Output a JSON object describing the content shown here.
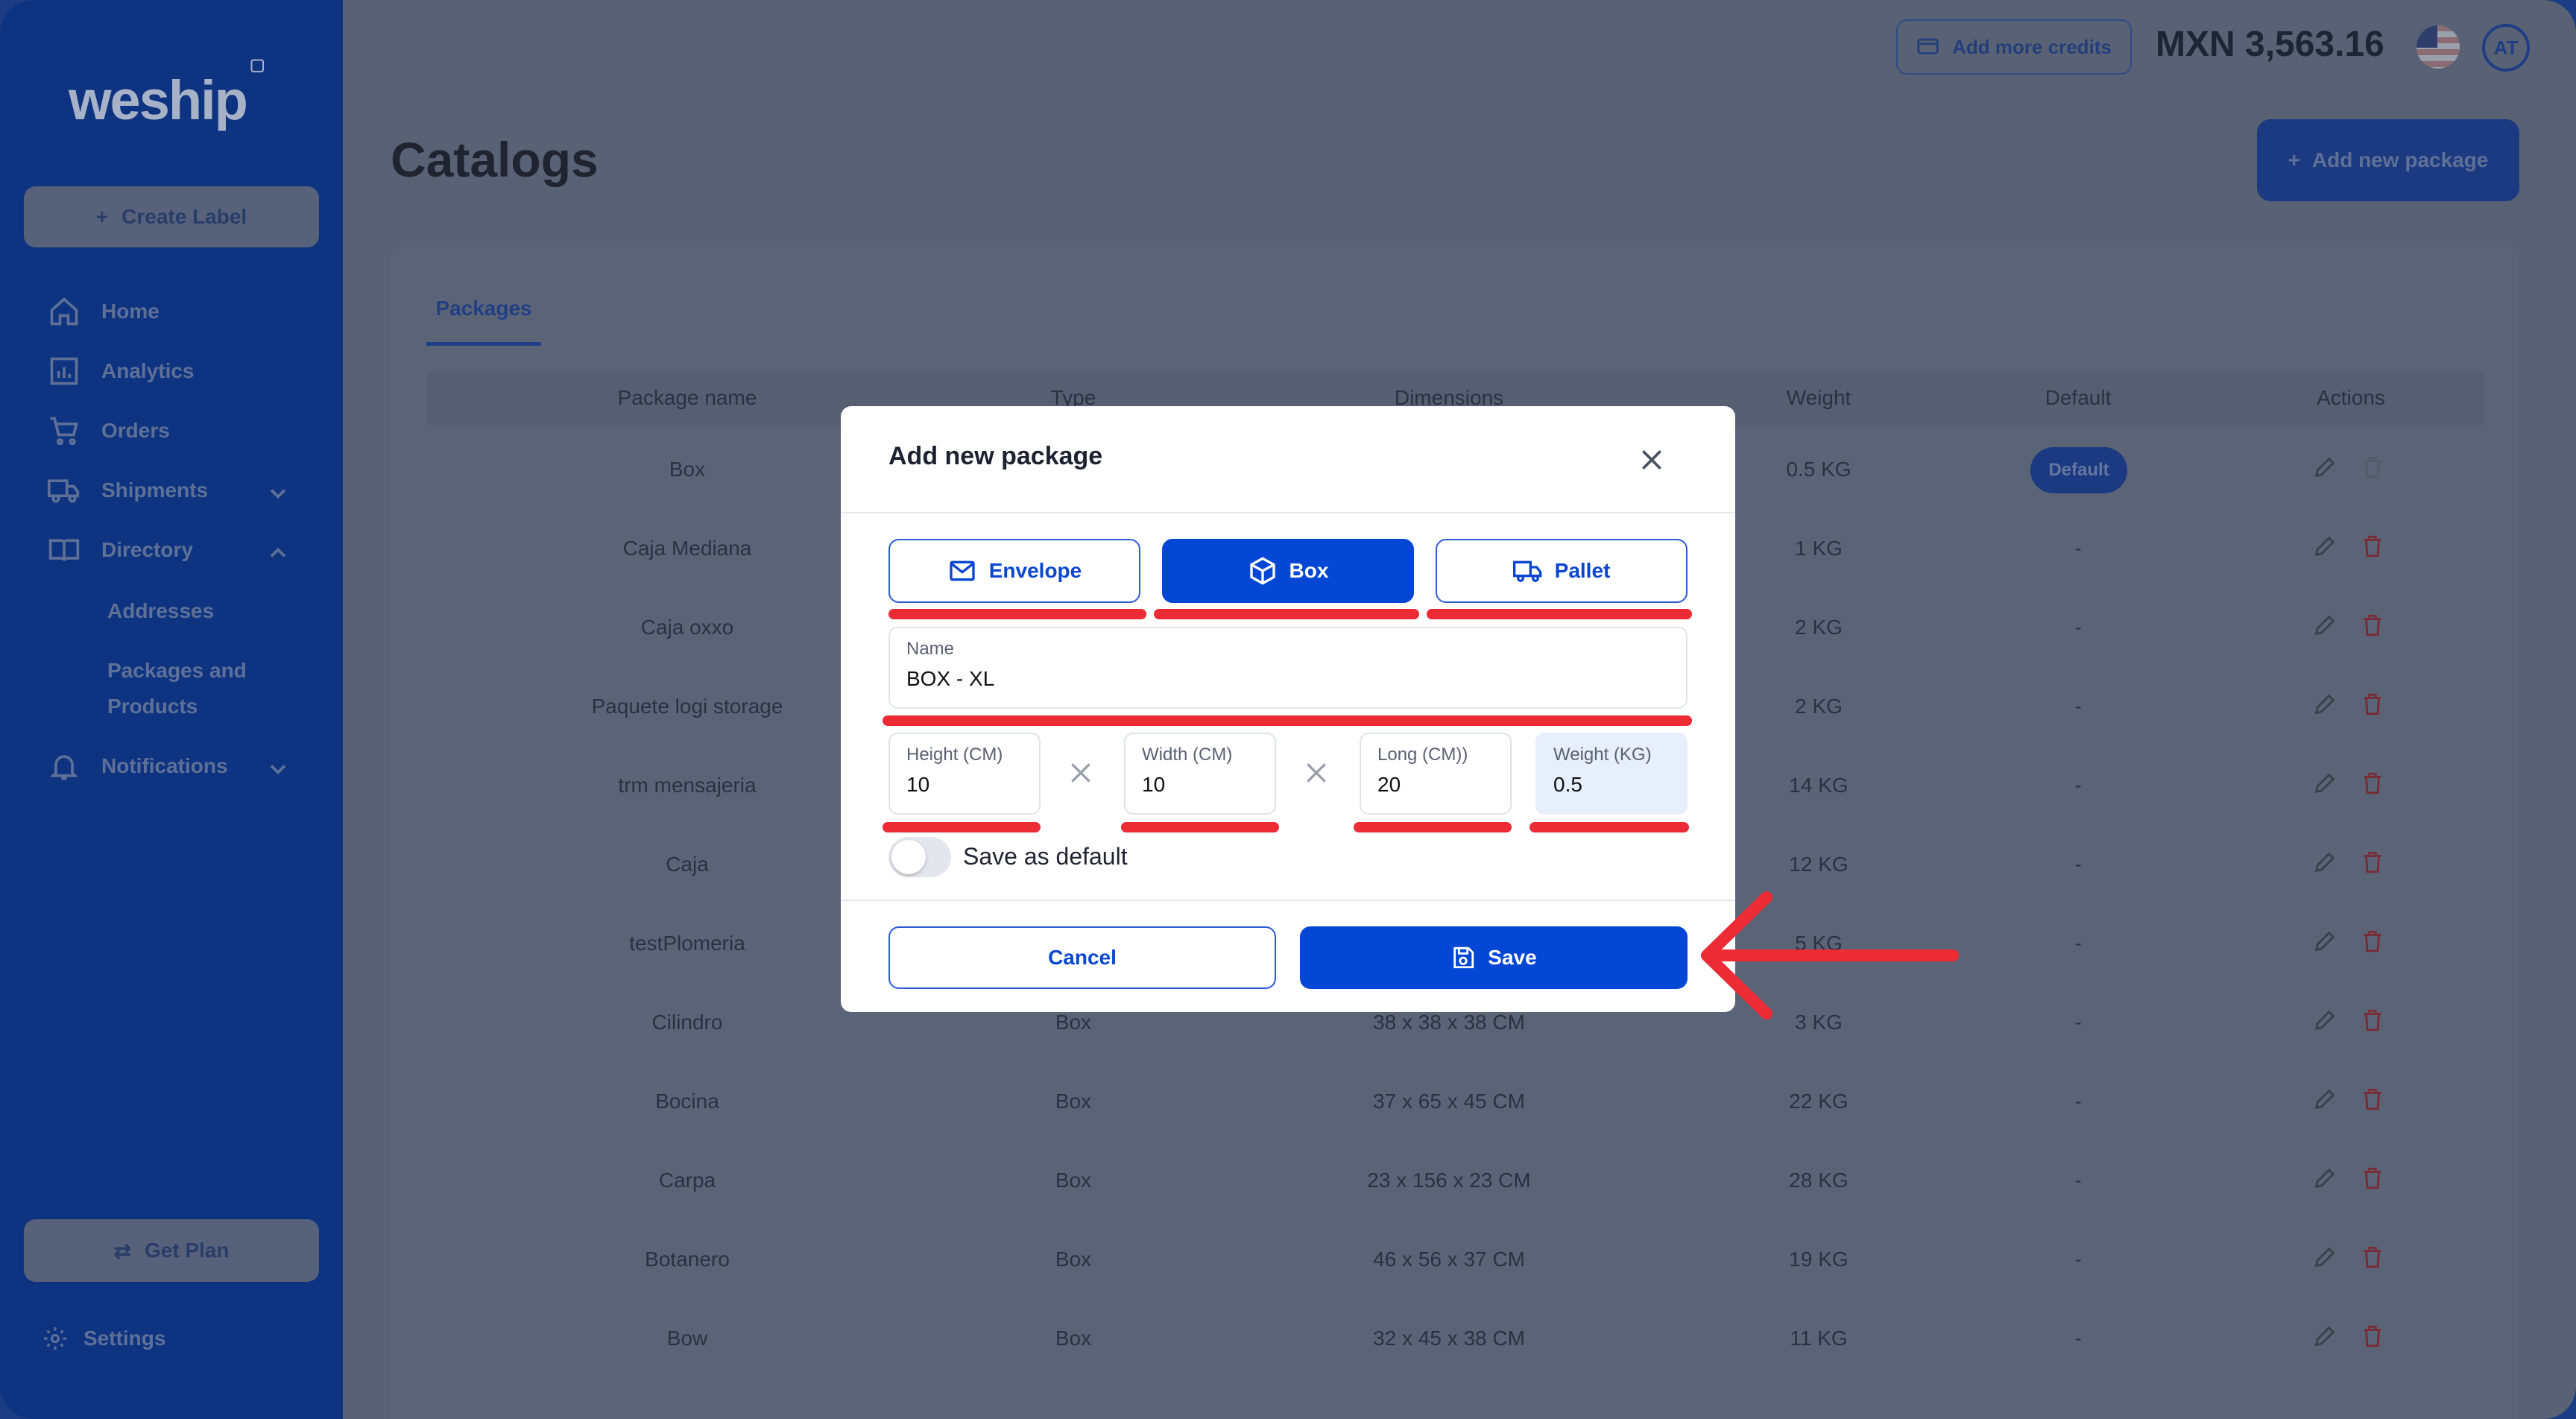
{
  "app": {
    "logo": "weship"
  },
  "sidebar": {
    "create_label": "Create Label",
    "items": [
      {
        "label": "Home",
        "icon": "home-icon"
      },
      {
        "label": "Analytics",
        "icon": "analytics-icon"
      },
      {
        "label": "Orders",
        "icon": "cart-icon"
      },
      {
        "label": "Shipments",
        "icon": "truck-icon"
      },
      {
        "label": "Directory",
        "icon": "book-icon"
      },
      {
        "label": "Notifications",
        "icon": "bell-icon"
      }
    ],
    "sub_items": [
      "Addresses",
      "Packages and",
      "Products"
    ],
    "get_plan": "Get Plan",
    "settings": "Settings"
  },
  "topbar": {
    "add_credits": "Add more credits",
    "balance": "MXN 3,563.16",
    "avatar_initials": "AT"
  },
  "page": {
    "title": "Catalogs",
    "add_package": "Add new package",
    "tab": "Packages"
  },
  "table": {
    "headers": [
      "Package name",
      "Type",
      "Dimensions",
      "Weight",
      "Default",
      "Actions"
    ],
    "rows": [
      {
        "name": "Box",
        "type": "",
        "dims": "",
        "weight": "0.5 KG",
        "default": "Default"
      },
      {
        "name": "Caja Mediana",
        "type": "",
        "dims": "",
        "weight": "1 KG",
        "default": "-"
      },
      {
        "name": "Caja oxxo",
        "type": "",
        "dims": "",
        "weight": "2 KG",
        "default": "-"
      },
      {
        "name": "Paquete logi storage",
        "type": "",
        "dims": "",
        "weight": "2 KG",
        "default": "-"
      },
      {
        "name": "trm mensajeria",
        "type": "",
        "dims": "",
        "weight": "14 KG",
        "default": "-"
      },
      {
        "name": "Caja",
        "type": "",
        "dims": "",
        "weight": "12 KG",
        "default": "-"
      },
      {
        "name": "testPlomeria",
        "type": "",
        "dims": "",
        "weight": "5 KG",
        "default": "-"
      },
      {
        "name": "Cilindro",
        "type": "Box",
        "dims": "38 x 38 x 38 CM",
        "weight": "3 KG",
        "default": "-"
      },
      {
        "name": "Bocina",
        "type": "Box",
        "dims": "37 x 65 x 45 CM",
        "weight": "22 KG",
        "default": "-"
      },
      {
        "name": "Carpa",
        "type": "Box",
        "dims": "23 x 156 x 23 CM",
        "weight": "28 KG",
        "default": "-"
      },
      {
        "name": "Botanero",
        "type": "Box",
        "dims": "46 x 56 x 37 CM",
        "weight": "19 KG",
        "default": "-"
      },
      {
        "name": "Bow",
        "type": "Box",
        "dims": "32 x 45 x 38 CM",
        "weight": "11 KG",
        "default": "-"
      }
    ]
  },
  "modal": {
    "title": "Add new package",
    "types": [
      "Envelope",
      "Box",
      "Pallet"
    ],
    "selected_type": "Box",
    "name_label": "Name",
    "name_value": "BOX - XL",
    "height_label": "Height (CM)",
    "height_value": "10",
    "width_label": "Width (CM)",
    "width_value": "10",
    "long_label": "Long (CM))",
    "long_value": "20",
    "weight_label": "Weight (KG)",
    "weight_value": "0.5",
    "save_default": "Save as default",
    "cancel": "Cancel",
    "save": "Save"
  },
  "colors": {
    "primary": "#0447d4",
    "sidebar": "#0e3481",
    "annotation": "#ec2b35"
  }
}
